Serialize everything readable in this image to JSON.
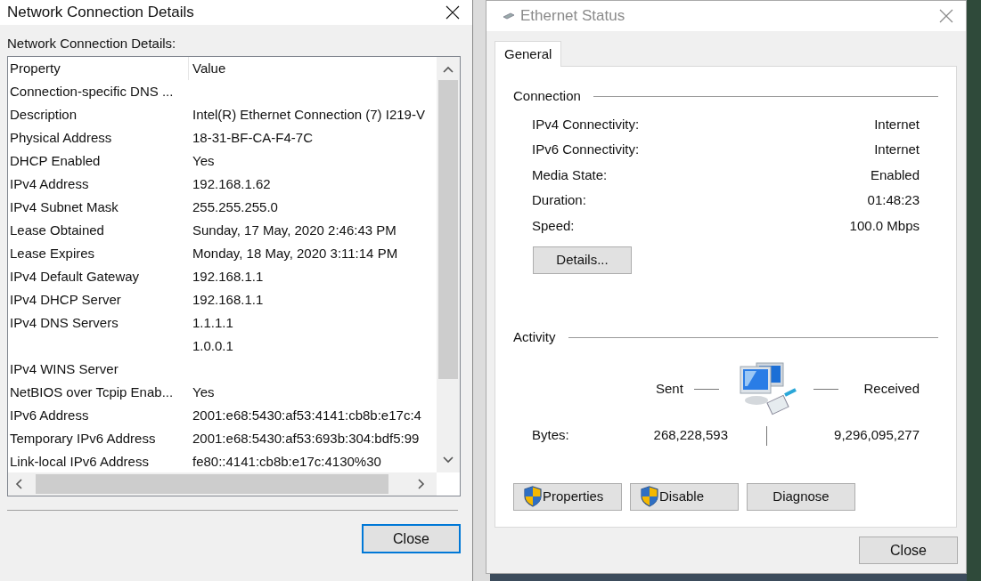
{
  "left_window": {
    "title": "Network Connection Details",
    "label": "Network Connection Details:",
    "columns": [
      "Property",
      "Value"
    ],
    "rows": [
      {
        "property": "Connection-specific DNS ...",
        "value": ""
      },
      {
        "property": "Description",
        "value": "Intel(R) Ethernet Connection (7) I219-V"
      },
      {
        "property": "Physical Address",
        "value": "18-31-BF-CA-F4-7C"
      },
      {
        "property": "DHCP Enabled",
        "value": "Yes"
      },
      {
        "property": "IPv4 Address",
        "value": "192.168.1.62"
      },
      {
        "property": "IPv4 Subnet Mask",
        "value": "255.255.255.0"
      },
      {
        "property": "Lease Obtained",
        "value": "Sunday, 17 May, 2020 2:46:43 PM"
      },
      {
        "property": "Lease Expires",
        "value": "Monday, 18 May, 2020 3:11:14 PM"
      },
      {
        "property": "IPv4 Default Gateway",
        "value": "192.168.1.1"
      },
      {
        "property": "IPv4 DHCP Server",
        "value": "192.168.1.1"
      },
      {
        "property": "IPv4 DNS Servers",
        "value": "1.1.1.1"
      },
      {
        "property": "",
        "value": "1.0.0.1"
      },
      {
        "property": "IPv4 WINS Server",
        "value": ""
      },
      {
        "property": "NetBIOS over Tcpip Enab...",
        "value": "Yes"
      },
      {
        "property": "IPv6 Address",
        "value": "2001:e68:5430:af53:4141:cb8b:e17c:4"
      },
      {
        "property": "Temporary IPv6 Address",
        "value": "2001:e68:5430:af53:693b:304:bdf5:99"
      },
      {
        "property": "Link-local IPv6 Address",
        "value": "fe80::4141:cb8b:e17c:4130%30"
      }
    ],
    "close_button": "Close"
  },
  "right_window": {
    "title": "Ethernet Status",
    "tabs": [
      {
        "label": "General",
        "selected": true
      }
    ],
    "connection": {
      "heading": "Connection",
      "rows": [
        {
          "label": "IPv4 Connectivity:",
          "value": "Internet"
        },
        {
          "label": "IPv6 Connectivity:",
          "value": "Internet"
        },
        {
          "label": "Media State:",
          "value": "Enabled"
        },
        {
          "label": "Duration:",
          "value": "01:48:23"
        },
        {
          "label": "Speed:",
          "value": "100.0 Mbps"
        }
      ],
      "details_button": "Details..."
    },
    "activity": {
      "heading": "Activity",
      "sent_label": "Sent",
      "received_label": "Received",
      "bytes_label": "Bytes:",
      "sent": "268,228,593",
      "received": "9,296,095,277"
    },
    "buttons": [
      {
        "label": "Properties",
        "shield": true
      },
      {
        "label": "Disable",
        "shield": true
      },
      {
        "label": "Diagnose",
        "shield": false
      }
    ],
    "close_button": "Close"
  }
}
